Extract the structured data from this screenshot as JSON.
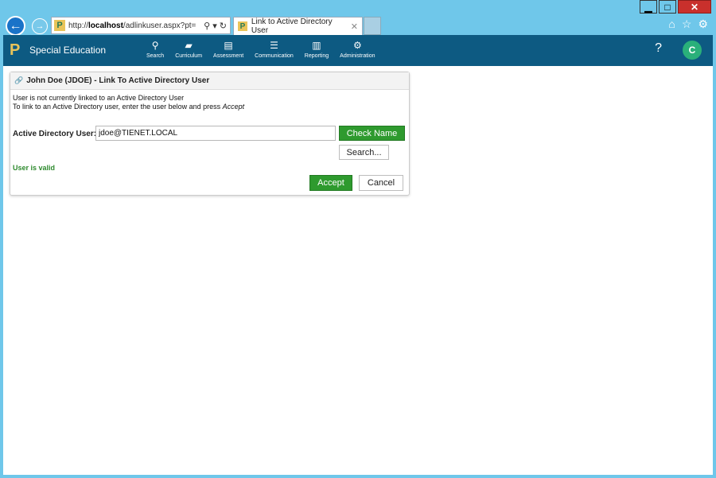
{
  "window": {
    "min": "▁",
    "max": "□",
    "close": "✕"
  },
  "browser": {
    "back_icon": "back-arrow-icon",
    "forward_icon": "forward-arrow-icon",
    "url_prefix": "http://",
    "url_host": "localhost",
    "url_path": "/adlinkuser.aspx?pt=",
    "address_tools": "⚲ ▾ ↻",
    "tab_title": "Link to Active Directory User",
    "tab_close": "✕",
    "tools": {
      "home": "⌂",
      "favorites": "☆",
      "settings": "⚙"
    }
  },
  "app": {
    "name": "Special Education",
    "logo_letter": "P",
    "nav": [
      {
        "label": "Search",
        "icon": "⚲"
      },
      {
        "label": "Curriculum",
        "icon": "▰"
      },
      {
        "label": "Assessment",
        "icon": "▤"
      },
      {
        "label": "Communication",
        "icon": "☰"
      },
      {
        "label": "Reporting",
        "icon": "▥"
      },
      {
        "label": "Administration",
        "icon": "⚙"
      }
    ],
    "help": "?",
    "avatar": "C"
  },
  "panel": {
    "title": "John Doe (JDOE) - Link To Active Directory User",
    "line1": "User is not currently linked to an Active Directory User",
    "line2": "To link to an Active Directory user, enter the user below and press ",
    "line2_em": "Accept",
    "ad_label": "Active Directory User:",
    "ad_value": "jdoe@TIENET.LOCAL",
    "check_name": "Check Name",
    "search": "Search...",
    "status": "User is valid",
    "accept": "Accept",
    "cancel": "Cancel"
  },
  "colors": {
    "accent_green": "#2e9a2e",
    "nav_blue": "#0d5a82",
    "frame": "#6fc7ea"
  }
}
